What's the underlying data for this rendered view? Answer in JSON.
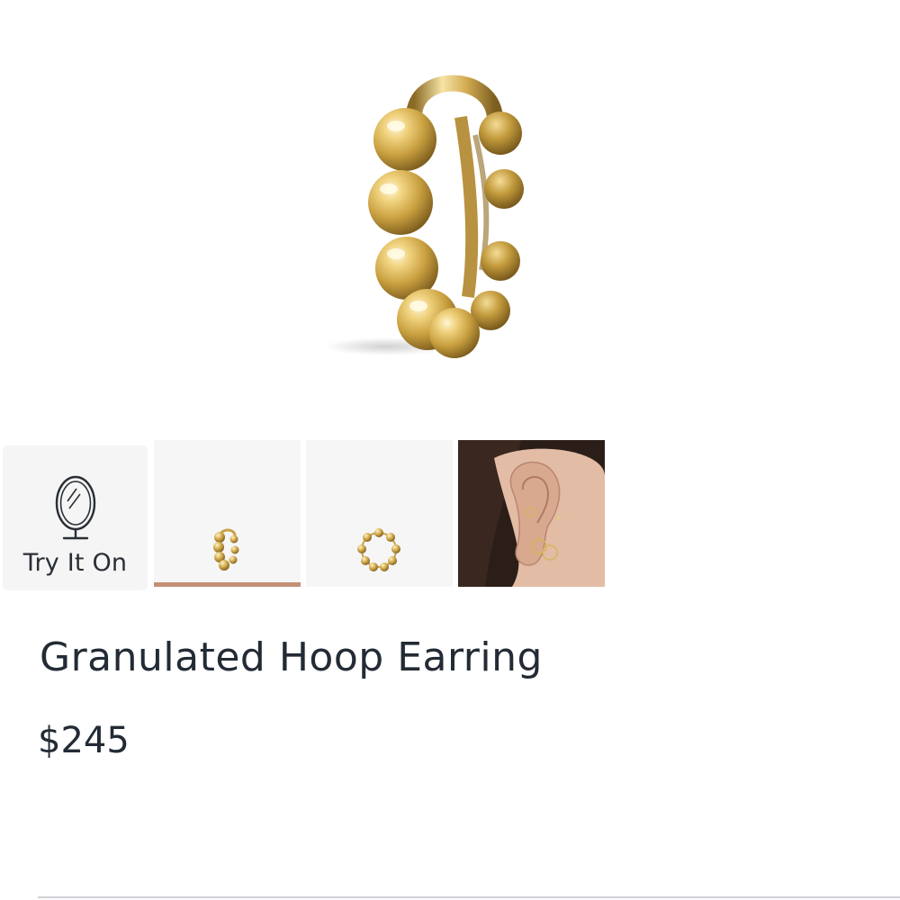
{
  "product": {
    "title": "Granulated Hoop Earring",
    "price": "$245",
    "accent_color": "#c58f77",
    "metal_color": "#d8b55a"
  },
  "gallery": {
    "main_image": "gold-granulated-hoop-side-view",
    "try_on_label": "Try It On",
    "try_on_icon": "mirror-icon",
    "thumbnails": [
      {
        "image": "hoop-side-view",
        "selected": true
      },
      {
        "image": "hoop-front-view",
        "selected": false
      },
      {
        "image": "model-ear-wearing-hoops",
        "selected": false
      }
    ]
  }
}
